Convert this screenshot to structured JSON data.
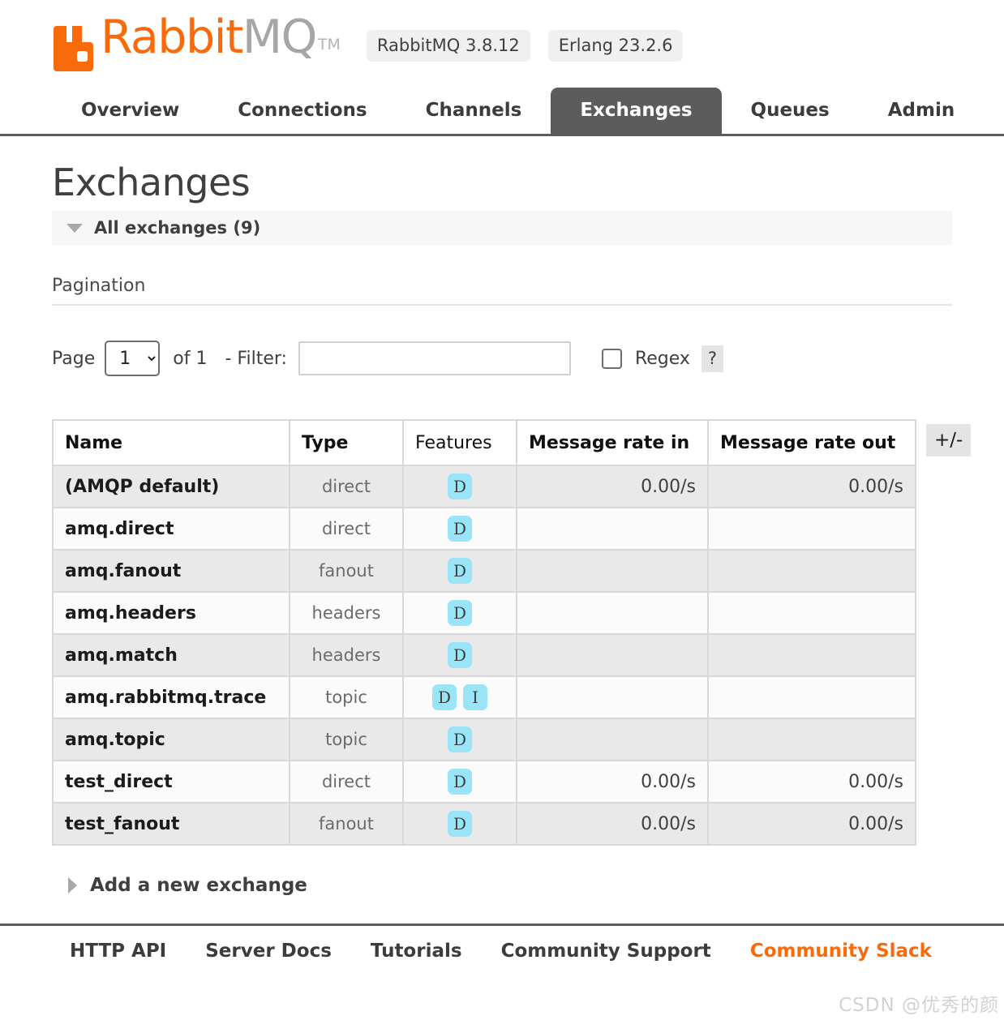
{
  "header": {
    "logo_rabbit": "Rabbit",
    "logo_mq": "MQ",
    "logo_tm": "TM",
    "logo_icon": "rabbit-logo-icon",
    "brand_color": "#f96a0b",
    "badges": [
      {
        "label": "RabbitMQ 3.8.12"
      },
      {
        "label": "Erlang 23.2.6"
      }
    ]
  },
  "nav": {
    "tabs": [
      {
        "label": "Overview",
        "active": false
      },
      {
        "label": "Connections",
        "active": false
      },
      {
        "label": "Channels",
        "active": false
      },
      {
        "label": "Exchanges",
        "active": true
      },
      {
        "label": "Queues",
        "active": false
      },
      {
        "label": "Admin",
        "active": false
      }
    ],
    "active_color": "#5c5c5c"
  },
  "main": {
    "page_title": "Exchanges",
    "section_label": "All exchanges (9)",
    "section_expanded": true,
    "pagination_title": "Pagination",
    "pagination": {
      "page_label": "Page",
      "page_value": "1",
      "page_options": [
        "1"
      ],
      "of_label": "of 1",
      "filter_dash": "-",
      "filter_label": "Filter:",
      "filter_value": "",
      "filter_placeholder": "",
      "regex_label": "Regex",
      "regex_checked": false,
      "help_label": "?"
    },
    "table": {
      "columns": [
        {
          "key": "name",
          "label": "Name",
          "bold": true
        },
        {
          "key": "type",
          "label": "Type",
          "bold": true
        },
        {
          "key": "features",
          "label": "Features",
          "bold": false
        },
        {
          "key": "rate_in",
          "label": "Message rate in",
          "bold": true
        },
        {
          "key": "rate_out",
          "label": "Message rate out",
          "bold": true
        }
      ],
      "toggle_columns_label": "+/-",
      "rows": [
        {
          "name": "(AMQP default)",
          "type": "direct",
          "features": [
            "D"
          ],
          "rate_in": "0.00/s",
          "rate_out": "0.00/s"
        },
        {
          "name": "amq.direct",
          "type": "direct",
          "features": [
            "D"
          ],
          "rate_in": "",
          "rate_out": ""
        },
        {
          "name": "amq.fanout",
          "type": "fanout",
          "features": [
            "D"
          ],
          "rate_in": "",
          "rate_out": ""
        },
        {
          "name": "amq.headers",
          "type": "headers",
          "features": [
            "D"
          ],
          "rate_in": "",
          "rate_out": ""
        },
        {
          "name": "amq.match",
          "type": "headers",
          "features": [
            "D"
          ],
          "rate_in": "",
          "rate_out": ""
        },
        {
          "name": "amq.rabbitmq.trace",
          "type": "topic",
          "features": [
            "D",
            "I"
          ],
          "rate_in": "",
          "rate_out": ""
        },
        {
          "name": "amq.topic",
          "type": "topic",
          "features": [
            "D"
          ],
          "rate_in": "",
          "rate_out": ""
        },
        {
          "name": "test_direct",
          "type": "direct",
          "features": [
            "D"
          ],
          "rate_in": "0.00/s",
          "rate_out": "0.00/s"
        },
        {
          "name": "test_fanout",
          "type": "fanout",
          "features": [
            "D"
          ],
          "rate_in": "0.00/s",
          "rate_out": "0.00/s"
        }
      ],
      "feature_badge_color": "#99e5f7"
    },
    "add_exchange_label": "Add a new exchange",
    "add_exchange_expanded": false
  },
  "footer": {
    "links": [
      {
        "label": "HTTP API",
        "highlight": false
      },
      {
        "label": "Server Docs",
        "highlight": false
      },
      {
        "label": "Tutorials",
        "highlight": false
      },
      {
        "label": "Community Support",
        "highlight": false
      },
      {
        "label": "Community Slack",
        "highlight": true
      }
    ]
  },
  "watermark": "CSDN @优秀的颜"
}
